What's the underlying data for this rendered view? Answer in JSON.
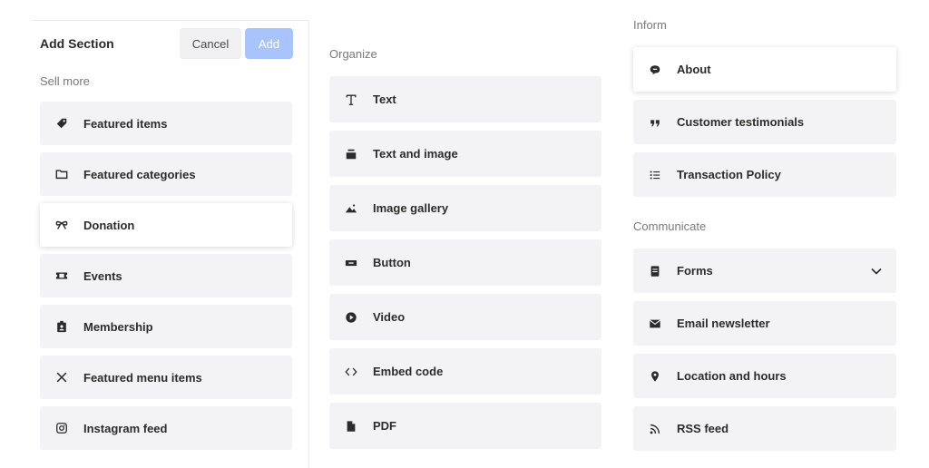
{
  "panel": {
    "title": "Add Section",
    "cancel_label": "Cancel",
    "add_label": "Add"
  },
  "sell_more": {
    "label": "Sell more",
    "items": [
      {
        "label": "Featured items",
        "icon": "tag-icon"
      },
      {
        "label": "Featured categories",
        "icon": "folder-icon"
      },
      {
        "label": "Donation",
        "icon": "ribbon-icon"
      },
      {
        "label": "Events",
        "icon": "ticket-icon"
      },
      {
        "label": "Membership",
        "icon": "badge-icon"
      },
      {
        "label": "Featured menu items",
        "icon": "utensils-icon"
      },
      {
        "label": "Instagram feed",
        "icon": "instagram-icon"
      }
    ]
  },
  "organize": {
    "label": "Organize",
    "items": [
      {
        "label": "Text",
        "icon": "text-icon"
      },
      {
        "label": "Text and image",
        "icon": "text-image-icon"
      },
      {
        "label": "Image gallery",
        "icon": "image-icon"
      },
      {
        "label": "Button",
        "icon": "button-icon"
      },
      {
        "label": "Video",
        "icon": "play-icon"
      },
      {
        "label": "Embed code",
        "icon": "code-icon"
      },
      {
        "label": "PDF",
        "icon": "file-icon"
      }
    ]
  },
  "inform": {
    "label": "Inform",
    "items": [
      {
        "label": "About",
        "icon": "chat-icon"
      },
      {
        "label": "Customer testimonials",
        "icon": "quote-icon"
      },
      {
        "label": "Transaction Policy",
        "icon": "list-icon"
      }
    ]
  },
  "communicate": {
    "label": "Communicate",
    "items": [
      {
        "label": "Forms",
        "icon": "form-icon"
      },
      {
        "label": "Email newsletter",
        "icon": "mail-icon"
      },
      {
        "label": "Location and hours",
        "icon": "pin-icon"
      },
      {
        "label": "RSS feed",
        "icon": "rss-icon"
      }
    ]
  },
  "colors": {
    "accent": "#a9c3fb",
    "tile": "#f3f3f5"
  }
}
